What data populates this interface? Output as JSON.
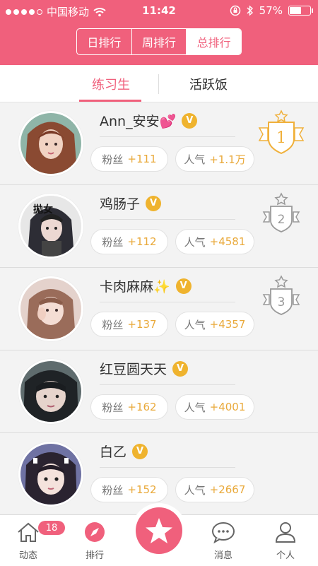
{
  "status_bar": {
    "carrier": "中国移动",
    "time": "11:42",
    "battery": "57%",
    "battery_level": 0.57
  },
  "header": {
    "segments": [
      {
        "label": "日排行",
        "active": false
      },
      {
        "label": "周排行",
        "active": false
      },
      {
        "label": "总排行",
        "active": true
      }
    ]
  },
  "tabs": [
    {
      "label": "练习生",
      "active": true
    },
    {
      "label": "活跃饭",
      "active": false
    }
  ],
  "verified_mark": "V",
  "fans_label": "粉丝",
  "popularity_label": "人气",
  "rows": [
    {
      "name": "Ann_安安💕",
      "fans": "+111",
      "popularity": "+1.1万",
      "rank": "1",
      "avatar_color": "#7aa69a"
    },
    {
      "name": "鸡肠子",
      "fans": "+112",
      "popularity": "+4581",
      "rank": "2",
      "avatar_color": "#3b3b44",
      "avatar_text": "拋女"
    },
    {
      "name": "卡肉麻麻✨",
      "fans": "+137",
      "popularity": "+4357",
      "rank": "3",
      "avatar_color": "#c9a39c"
    },
    {
      "name": "红豆圆天天",
      "fans": "+162",
      "popularity": "+4001",
      "rank": "",
      "avatar_color": "#4f5a5c"
    },
    {
      "name": "白乙",
      "fans": "+152",
      "popularity": "+2667",
      "rank": "",
      "avatar_color": "#5b5f86"
    }
  ],
  "tabbar": {
    "items": [
      {
        "label": "动态",
        "icon": "home-icon",
        "badge": "18"
      },
      {
        "label": "排行",
        "icon": "compass-icon"
      },
      {
        "label": "",
        "icon": "star-icon"
      },
      {
        "label": "消息",
        "icon": "chat-icon"
      },
      {
        "label": "个人",
        "icon": "person-icon"
      }
    ]
  },
  "colors": {
    "accent": "#f0607c",
    "gold": "#e9a93a",
    "rank1": "#f0b03a",
    "rank_other": "#999999"
  }
}
